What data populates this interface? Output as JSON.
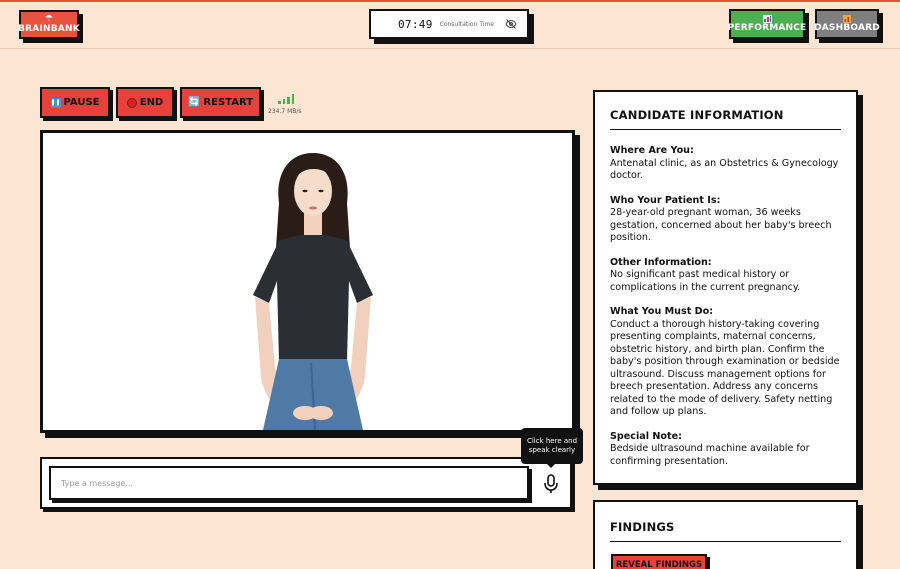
{
  "header": {
    "brainbank": {
      "icon": "umbrella-icon",
      "label": "BRAINBANK"
    },
    "timer": {
      "time": "07:49",
      "label": "Consultation Time",
      "icon": "eye-off-icon"
    },
    "performance": {
      "icon": "bar-chart-icon",
      "label": "PERFORMANCE"
    },
    "dashboard": {
      "icon": "dashboard-icon",
      "label": "DASHBOARD"
    }
  },
  "controls": {
    "pause": {
      "icon": "pause-icon",
      "label": "PAUSE"
    },
    "end": {
      "icon": "red-circle-icon",
      "label": "END"
    },
    "restart": {
      "icon": "refresh-icon",
      "label": "RESTART"
    },
    "network": {
      "icon": "signal-bars-icon",
      "speed": "234.7 MB/s"
    }
  },
  "video": {
    "content": "patient-avatar"
  },
  "message": {
    "placeholder": "Type a message...",
    "mic_icon": "microphone-icon"
  },
  "tooltip": {
    "text": "Click here and speak clearly"
  },
  "candidate": {
    "title": "CANDIDATE INFORMATION",
    "sections": [
      {
        "label": "Where Are You:",
        "text": "Antenatal clinic, as an Obstetrics & Gynecology doctor."
      },
      {
        "label": "Who Your Patient Is:",
        "text": "28-year-old pregnant woman, 36 weeks gestation, concerned about her baby's breech position."
      },
      {
        "label": "Other Information:",
        "text": "No significant past medical history or complications in the current pregnancy."
      },
      {
        "label": "What You Must Do:",
        "text": "Conduct a thorough history-taking covering presenting complaints, maternal concerns, obstetric history, and birth plan. Confirm the baby's position through examination or bedside ultrasound. Discuss management options for breech presentation. Address any concerns related to the mode of delivery. Safety netting and follow up plans."
      },
      {
        "label": "Special Note:",
        "text": "Bedside ultrasound machine available for confirming presentation."
      }
    ]
  },
  "findings": {
    "title": "FINDINGS",
    "button": "REVEAL FINDINGS"
  },
  "colors": {
    "background": "#fde5d3",
    "accent_red": "#e8413c",
    "performance_green": "#4caf50",
    "dashboard_gray": "#7f7f7f",
    "border": "#111111"
  }
}
